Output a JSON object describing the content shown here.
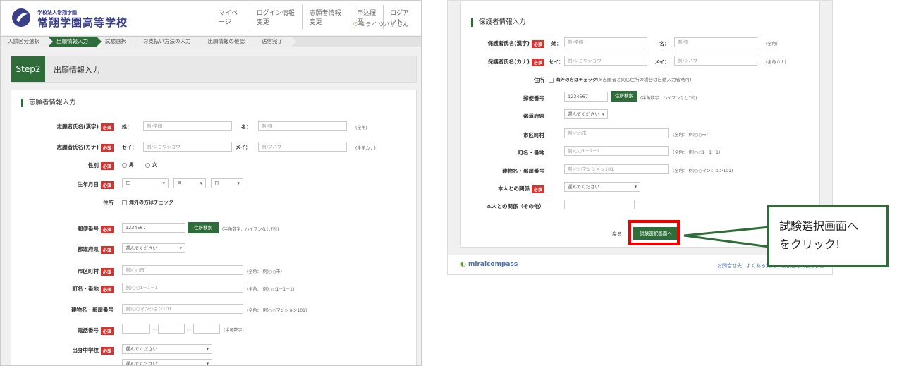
{
  "left": {
    "school_small": "学校法人常翔学園",
    "school_name": "常翔学園高等学校",
    "topnav": [
      "マイページ",
      "ログイン情報変更",
      "志願者情報変更",
      "申込履歴",
      "ログアウト"
    ],
    "user": "ミライ ツバサ さん",
    "steps": [
      "入試区分選択",
      "出願情報入力",
      "試験選択",
      "お支払い方法の入力",
      "出願情報の確認",
      "送信完了"
    ],
    "step_badge": "Step2",
    "step_title": "出願情報入力",
    "section": "志願者情報入力",
    "required": "必須",
    "name_kanji": {
      "label": "志願者氏名(漢字)",
      "sei": "姓：",
      "sei_ph": "例)常翔",
      "mei": "名：",
      "mei_ph": "例)翔",
      "note": "(全角)"
    },
    "name_kana": {
      "label": "志願者氏名(カナ)",
      "sei": "セイ：",
      "sei_ph": "例)ジョウショウ",
      "mei": "メイ：",
      "mei_ph": "例)ツバサ",
      "note": "(全角カナ)"
    },
    "gender": {
      "label": "性別",
      "male": "男",
      "female": "女"
    },
    "birth": {
      "label": "生年月日",
      "year": "年",
      "month": "月",
      "day": "日"
    },
    "address": {
      "label": "住所",
      "check": "海外の方はチェック"
    },
    "zip": {
      "label": "郵便番号",
      "value": "1234567",
      "button": "住所検索",
      "note": "(半角数字：ハイフンなし7桁)"
    },
    "pref": {
      "label": "都道府県",
      "value": "選んでください"
    },
    "city": {
      "label": "市区町村",
      "ph": "例)○○市",
      "note": "(全角：(例)○○市)"
    },
    "town": {
      "label": "町名・番地",
      "ph": "例)○○1－1－1",
      "note": "(全角：(例)○○1－1－1)"
    },
    "building": {
      "label": "建物名・部屋番号",
      "ph": "例)○○マンション101",
      "note": "(全角：(例)○○マンション101)"
    },
    "phone": {
      "label": "電話番号",
      "dash": "－",
      "note": "(半角数字)"
    },
    "school": {
      "label": "出身中学校",
      "value": "選んでください",
      "value2": "選んでください"
    }
  },
  "right": {
    "section": "保護者情報入力",
    "required": "必須",
    "name_kanji": {
      "label": "保護者氏名(漢字)",
      "sei": "姓：",
      "sei_ph": "例)常翔",
      "mei": "名：",
      "mei_ph": "例)翔",
      "note": "(全角)"
    },
    "name_kana": {
      "label": "保護者氏名(カナ)",
      "sei": "セイ：",
      "sei_ph": "例)ジョウショウ",
      "mei": "メイ：",
      "mei_ph": "例)ツバサ",
      "note": "(全角カナ)"
    },
    "address": {
      "label": "住所",
      "check": "海外の方はチェック",
      "note": "(※志願者と同じ住所の場合は自動入力省略可)"
    },
    "zip": {
      "label": "郵便番号",
      "value": "1234567",
      "button": "住所検索",
      "note": "(半角数字：ハイフンなし7桁)"
    },
    "pref": {
      "label": "都道府県",
      "value": "選んでください"
    },
    "city": {
      "label": "市区町村",
      "ph": "例)○○市",
      "note": "(全角：(例)○○市)"
    },
    "town": {
      "label": "町名・番地",
      "ph": "例)○○1－1－1",
      "note": "(全角：(例)○○1－1－1)"
    },
    "building": {
      "label": "建物名・部屋番号",
      "ph": "例)○○マンション101",
      "note": "(全角：(例)○○マンション101)"
    },
    "relation": {
      "label": "本人との関係",
      "value": "選んでください"
    },
    "relation_other": {
      "label": "本人との関係（その他）"
    },
    "back": "戻る",
    "next": "試験選択画面へ",
    "footer_logo": "miraicompass",
    "footer_links": [
      "お問合せ先",
      "よくある質問",
      "利用規約",
      "推奨環境"
    ]
  },
  "callout": {
    "line1": "試験選択画面へ",
    "line2": "をクリック!"
  },
  "colors": {
    "green": "#2e6d3a",
    "red": "#d9312c",
    "highlight": "#e00000"
  }
}
